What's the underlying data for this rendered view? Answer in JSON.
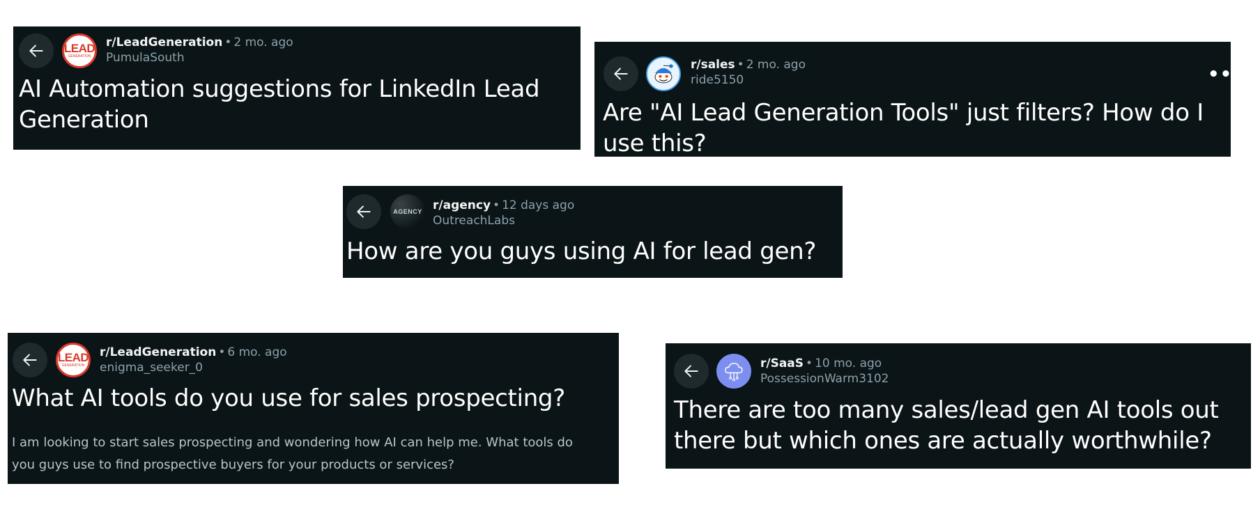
{
  "posts": [
    {
      "subreddit": "r/LeadGeneration",
      "time": "2 mo. ago",
      "author": "PumulaSouth",
      "title_lines": [
        "AI Automation suggestions for LinkedIn Lead",
        "Generation"
      ],
      "avatar": {
        "type": "lead-generation-logo",
        "text_big": "LEAD",
        "text_small": "GENERATION"
      }
    },
    {
      "subreddit": "r/sales",
      "time": "2 mo. ago",
      "author": "ride5150",
      "title_lines": [
        "Are \"AI Lead Generation Tools\" just filters? How do I",
        "use this?"
      ],
      "more": "•••",
      "avatar": {
        "type": "snoo-icon"
      }
    },
    {
      "subreddit": "r/agency",
      "time": "12 days ago",
      "author": "OutreachLabs",
      "title_lines": [
        "How are you guys using AI for lead gen?"
      ],
      "avatar": {
        "type": "agency-logo",
        "text": "AGENCY"
      }
    },
    {
      "subreddit": "r/LeadGeneration",
      "time": "6 mo. ago",
      "author": "enigma_seeker_0",
      "title_lines": [
        "What AI tools do you use for sales prospecting?"
      ],
      "body_lines": [
        "I am looking to start sales prospecting and wondering how AI can help me. What tools do",
        "you guys use to find prospective buyers for your products or services?"
      ],
      "avatar": {
        "type": "lead-generation-logo",
        "text_big": "LEAD",
        "text_small": "GENERATION"
      }
    },
    {
      "subreddit": "r/SaaS",
      "time": "10 mo. ago",
      "author": "PossessionWarm3102",
      "title_lines": [
        "There are too many sales/lead gen AI tools out",
        "there but which ones are actually worthwhile?"
      ],
      "avatar": {
        "type": "cloud-circuit-icon"
      }
    }
  ],
  "separator": "•",
  "colors": {
    "card_bg": "#0b1416",
    "muted": "#8ba2ad",
    "lead_red": "#d93a2b",
    "saas_purple": "#7c8ef0"
  }
}
